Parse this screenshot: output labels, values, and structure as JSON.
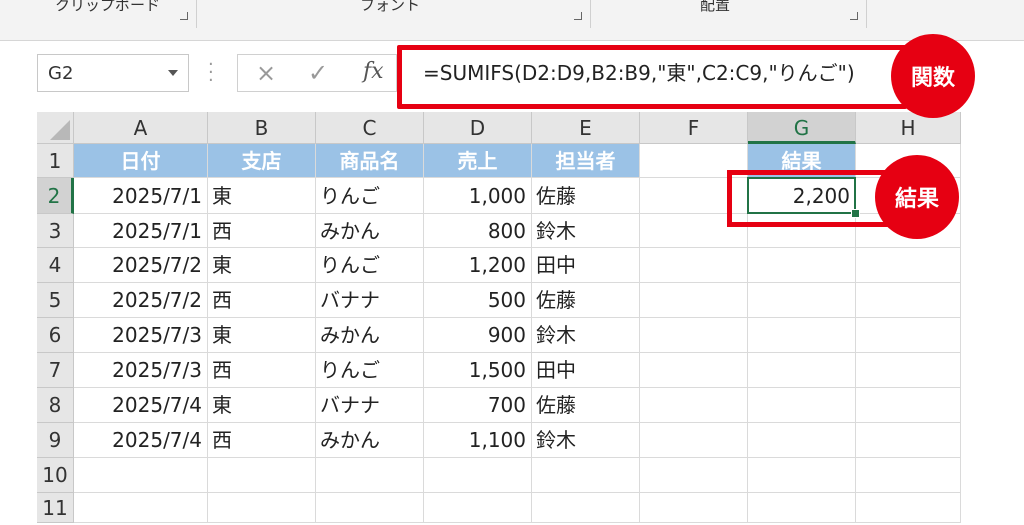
{
  "ribbon": {
    "groups": [
      {
        "label": "クリップボード"
      },
      {
        "label": "フォント"
      },
      {
        "label": "配置"
      }
    ]
  },
  "formula_bar": {
    "name_box": "G2",
    "cancel_icon": "×",
    "enter_icon": "✓",
    "fx_label": "fx",
    "formula": "=SUMIFS(D2:D9,B2:B9,\"東\",C2:C9,\"りんご\")"
  },
  "annotations": {
    "formula_callout": "関数",
    "result_callout": "結果"
  },
  "sheet": {
    "columns": [
      "A",
      "B",
      "C",
      "D",
      "E",
      "F",
      "G",
      "H"
    ],
    "active_column": "G",
    "active_row": "2",
    "rows": [
      "1",
      "2",
      "3",
      "4",
      "5",
      "6",
      "7",
      "8",
      "9",
      "10",
      "11"
    ],
    "headers": [
      "日付",
      "支店",
      "商品名",
      "売上",
      "担当者"
    ],
    "data": [
      [
        "2025/7/1",
        "東",
        "りんご",
        "1,000",
        "佐藤"
      ],
      [
        "2025/7/1",
        "西",
        "みかん",
        "800",
        "鈴木"
      ],
      [
        "2025/7/2",
        "東",
        "りんご",
        "1,200",
        "田中"
      ],
      [
        "2025/7/2",
        "西",
        "バナナ",
        "500",
        "佐藤"
      ],
      [
        "2025/7/3",
        "東",
        "みかん",
        "900",
        "鈴木"
      ],
      [
        "2025/7/3",
        "西",
        "りんご",
        "1,500",
        "田中"
      ],
      [
        "2025/7/4",
        "東",
        "バナナ",
        "700",
        "佐藤"
      ],
      [
        "2025/7/4",
        "西",
        "みかん",
        "1,100",
        "鈴木"
      ]
    ],
    "result_header": "結果",
    "result_value": "2,200"
  },
  "colors": {
    "header_fill": "#9bc2e6",
    "selection": "#217346",
    "highlight": "#e60012"
  }
}
